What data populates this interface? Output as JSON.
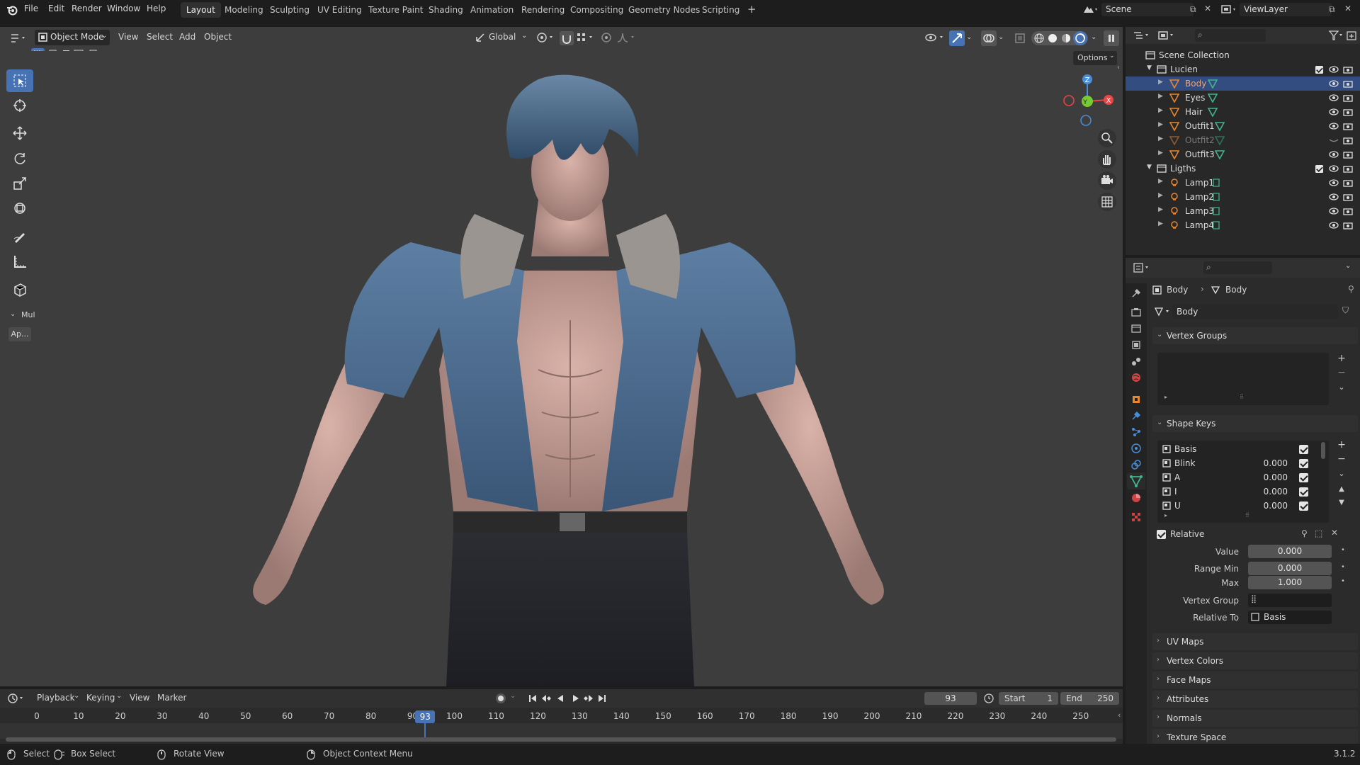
{
  "topbar": {
    "menus": [
      "File",
      "Edit",
      "Render",
      "Window",
      "Help"
    ],
    "workspaces": [
      "Layout",
      "Modeling",
      "Sculpting",
      "UV Editing",
      "Texture Paint",
      "Shading",
      "Animation",
      "Rendering",
      "Compositing",
      "Geometry Nodes",
      "Scripting"
    ],
    "active_workspace": "Layout",
    "add_tab": "+",
    "scene": "Scene",
    "view_layer": "ViewLayer"
  },
  "viewport_header": {
    "mode": "Object Mode",
    "menus": [
      "View",
      "Select",
      "Add",
      "Object"
    ],
    "orientation": "Global",
    "options": "Options"
  },
  "toolbar": {
    "panel_label": "Mul",
    "apply_button": "Ap..."
  },
  "gizmo": {
    "z": "Z",
    "y": "Y",
    "x": "X"
  },
  "outliner": {
    "root": "Scene Collection",
    "collections": [
      {
        "name": "Lucien",
        "objects": [
          "Body",
          "Eyes",
          "Hair",
          "Outfit1",
          "Outfit2",
          "Outfit3"
        ]
      },
      {
        "name": "Ligths",
        "objects": [
          "Lamp1",
          "Lamp2",
          "Lamp3",
          "Lamp4"
        ]
      }
    ],
    "selected": "Body",
    "hidden": "Outfit2"
  },
  "properties": {
    "breadcrumb": [
      "Body",
      "Body"
    ],
    "data_name": "Body",
    "panels": {
      "vertex_groups": "Vertex Groups",
      "shape_keys": "Shape Keys",
      "uv_maps": "UV Maps",
      "vertex_colors": "Vertex Colors",
      "face_maps": "Face Maps",
      "attributes": "Attributes",
      "normals": "Normals",
      "texture_space": "Texture Space"
    },
    "shape_keys": [
      {
        "name": "Basis",
        "value": ""
      },
      {
        "name": "Blink",
        "value": "0.000"
      },
      {
        "name": "A",
        "value": "0.000"
      },
      {
        "name": "I",
        "value": "0.000"
      },
      {
        "name": "U",
        "value": "0.000"
      }
    ],
    "relative_label": "Relative",
    "value_label": "Value",
    "value": "0.000",
    "range_min_label": "Range Min",
    "range_min": "0.000",
    "max_label": "Max",
    "max": "1.000",
    "vertex_group_label": "Vertex Group",
    "relative_to_label": "Relative To",
    "relative_to": "Basis"
  },
  "timeline": {
    "menus": [
      "Playback",
      "Keying",
      "View",
      "Marker"
    ],
    "current_frame": "93",
    "start_label": "Start",
    "start": "1",
    "end_label": "End",
    "end": "250",
    "ticks": [
      "0",
      "10",
      "20",
      "30",
      "40",
      "50",
      "60",
      "70",
      "80",
      "90",
      "100",
      "110",
      "120",
      "130",
      "140",
      "150",
      "160",
      "170",
      "180",
      "190",
      "200",
      "210",
      "220",
      "230",
      "240",
      "250"
    ],
    "playhead": "93"
  },
  "statusbar": {
    "select": "Select",
    "box_select": "Box Select",
    "rotate_view": "Rotate View",
    "context_menu": "Object Context Menu",
    "version": "3.1.2"
  },
  "colors": {
    "accent": "#4772b3",
    "viewport_bg": "#3d3d3d",
    "selected_row": "#334d80",
    "object_orange": "#e8852f",
    "mesh_green": "#3fb68b"
  }
}
